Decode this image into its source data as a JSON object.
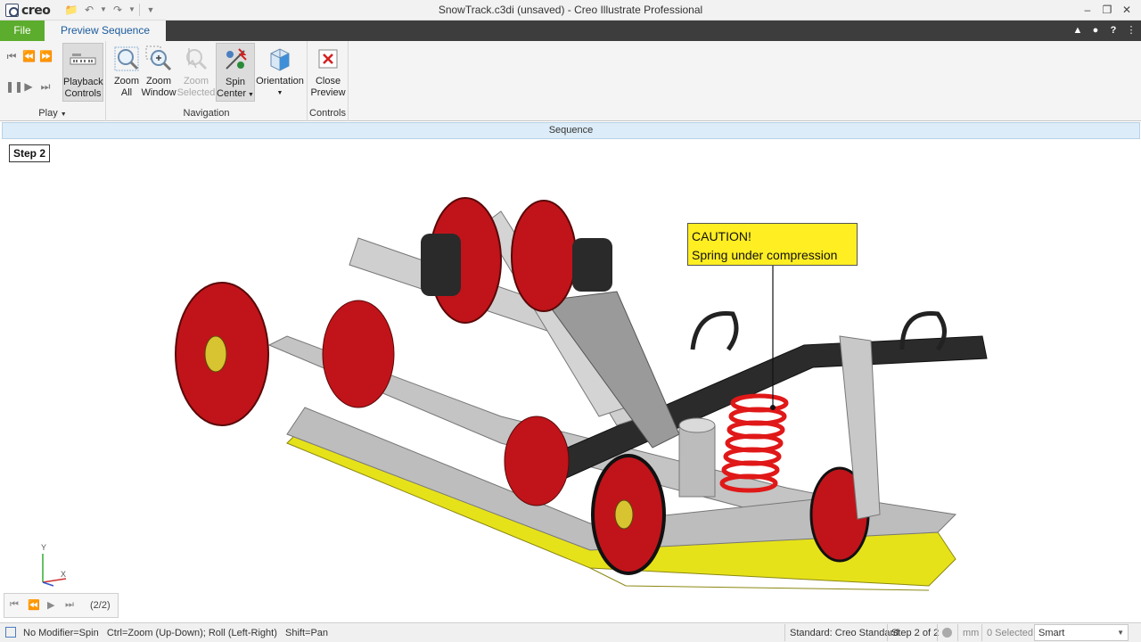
{
  "app": {
    "window_title": "SnowTrack.c3di (unsaved) - Creo Illustrate Professional",
    "logo_text": "creo"
  },
  "tabs": {
    "file": "File",
    "preview": "Preview Sequence"
  },
  "ribbon": {
    "play_group": "Play",
    "navigation_group": "Navigation",
    "controls_group": "Controls",
    "playback_controls": [
      "Playback",
      "Controls"
    ],
    "zoom_all": [
      "Zoom",
      "All"
    ],
    "zoom_window": [
      "Zoom",
      "Window"
    ],
    "zoom_selected": [
      "Zoom",
      "Selected"
    ],
    "spin_center": [
      "Spin",
      "Center"
    ],
    "orientation": "Orientation",
    "close_preview": [
      "Close",
      "Preview"
    ]
  },
  "sequence_bar": "Sequence",
  "viewport": {
    "step_label": "Step 2",
    "callout_line1": "CAUTION!",
    "callout_line2": "Spring under compression",
    "triad_y": "Y",
    "triad_x": "X",
    "step_counter": "(2/2)"
  },
  "status": {
    "hint": "No Modifier=Spin   Ctrl=Zoom (Up-Down); Roll (Left-Right)   Shift=Pan",
    "standard": "Standard: Creo Standard",
    "step": "Step 2 of 2",
    "units": "mm",
    "selected": "0 Selected",
    "filter": "Smart"
  },
  "colors": {
    "file_tab": "#5cac2d",
    "tabbar": "#3d3d3d",
    "wheel_red": "#c0141a",
    "frame_gray": "#b8b8b8",
    "track_yellow": "#e6e21a",
    "callout_yellow": "#ffee22",
    "spring_red": "#e01818"
  }
}
